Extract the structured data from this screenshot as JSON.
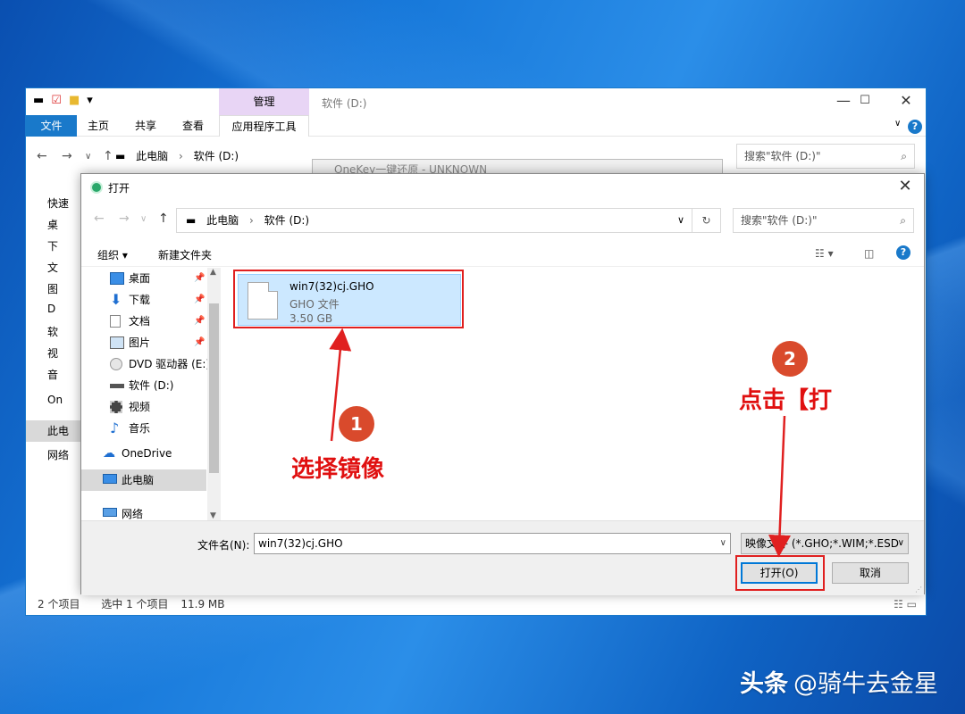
{
  "explorer": {
    "context_tab": "管理",
    "title": "软件 (D:)",
    "ribbon_tabs": [
      "文件",
      "主页",
      "共享",
      "查看",
      "应用程序工具"
    ],
    "address": [
      "此电脑",
      "软件 (D:)"
    ],
    "search_placeholder": "搜索\"软件 (D:)\"",
    "sidebar": [
      "快速",
      "桌",
      "下",
      "文",
      "图",
      "D",
      "软",
      "视",
      "音",
      "On",
      "此电",
      "网络"
    ],
    "status": {
      "items": "2 个项目",
      "selected": "选中 1 个项目",
      "size": "11.9 MB"
    }
  },
  "background_window_title": "OneKey一键还原 - UNKNOWN",
  "dialog": {
    "title": "打开",
    "address": [
      "此电脑",
      "软件 (D:)"
    ],
    "search_placeholder": "搜索\"软件 (D:)\"",
    "organize": "组织 ▾",
    "new_folder": "新建文件夹",
    "tree": [
      {
        "label": "桌面",
        "icon": "desktop-icon",
        "pinned": true
      },
      {
        "label": "下载",
        "icon": "download-icon",
        "pinned": true
      },
      {
        "label": "文档",
        "icon": "document-icon",
        "pinned": true
      },
      {
        "label": "图片",
        "icon": "picture-icon",
        "pinned": true
      },
      {
        "label": "DVD 驱动器 (E:)",
        "icon": "dvd-icon",
        "pinned": false
      },
      {
        "label": "软件 (D:)",
        "icon": "drive-icon",
        "pinned": false
      },
      {
        "label": "视频",
        "icon": "video-icon",
        "pinned": false
      },
      {
        "label": "音乐",
        "icon": "music-icon",
        "pinned": false
      },
      {
        "label": "OneDrive",
        "icon": "cloud-icon",
        "pinned": false
      },
      {
        "label": "此电脑",
        "icon": "computer-icon",
        "pinned": false
      },
      {
        "label": "网络",
        "icon": "network-icon",
        "pinned": false
      }
    ],
    "file": {
      "name": "win7(32)cj.GHO",
      "type": "GHO 文件",
      "size": "3.50 GB"
    },
    "filename_label": "文件名(N):",
    "filename_value": "win7(32)cj.GHO",
    "filter": "映像文件 (*.GHO;*.WIM;*.ESD",
    "open_button": "打开(O)",
    "cancel_button": "取消"
  },
  "annotations": {
    "step1_number": "1",
    "step1_text": "选择镜像",
    "step2_number": "2",
    "step2_text": "点击【打"
  },
  "watermark": {
    "brand": "头条",
    "handle": "@骑牛去金星"
  },
  "colors": {
    "accent": "#1979ca",
    "annotation_red": "#e02020",
    "badge": "#d94a2c",
    "selection": "#cce8ff"
  }
}
